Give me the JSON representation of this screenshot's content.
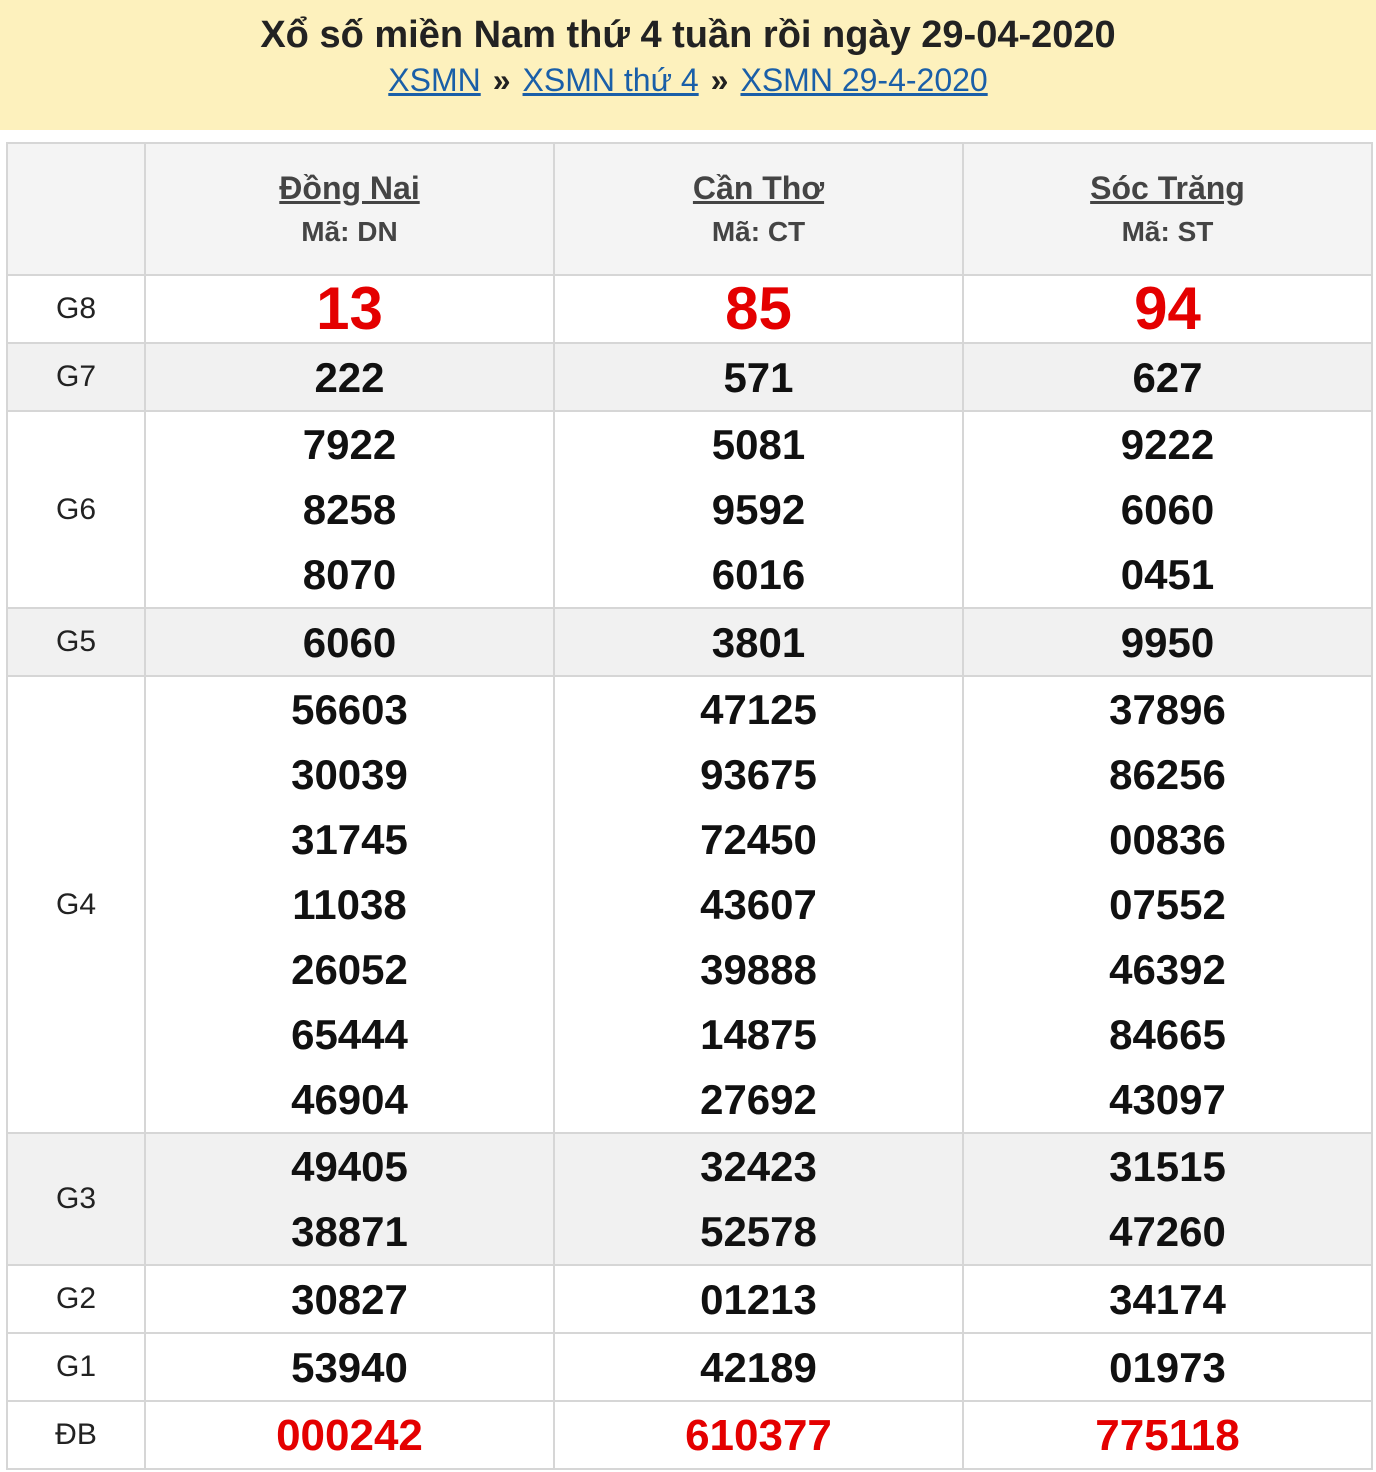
{
  "header": {
    "title": "Xổ số miền Nam thứ 4 tuần rồi ngày 29-04-2020",
    "breadcrumb": [
      "XSMN",
      "XSMN thứ 4",
      "XSMN 29-4-2020"
    ],
    "separator": "»"
  },
  "provinces": [
    {
      "name": "Đồng Nai",
      "code": "Mã: DN"
    },
    {
      "name": "Cần Thơ",
      "code": "Mã: CT"
    },
    {
      "name": "Sóc Trăng",
      "code": "Mã: ST"
    }
  ],
  "prizes": [
    {
      "label": "G8",
      "values": [
        [
          "13"
        ],
        [
          "85"
        ],
        [
          "94"
        ]
      ]
    },
    {
      "label": "G7",
      "values": [
        [
          "222"
        ],
        [
          "571"
        ],
        [
          "627"
        ]
      ]
    },
    {
      "label": "G6",
      "values": [
        [
          "7922",
          "8258",
          "8070"
        ],
        [
          "5081",
          "9592",
          "6016"
        ],
        [
          "9222",
          "6060",
          "0451"
        ]
      ]
    },
    {
      "label": "G5",
      "values": [
        [
          "6060"
        ],
        [
          "3801"
        ],
        [
          "9950"
        ]
      ]
    },
    {
      "label": "G4",
      "values": [
        [
          "56603",
          "30039",
          "31745",
          "11038",
          "26052",
          "65444",
          "46904"
        ],
        [
          "47125",
          "93675",
          "72450",
          "43607",
          "39888",
          "14875",
          "27692"
        ],
        [
          "37896",
          "86256",
          "00836",
          "07552",
          "46392",
          "84665",
          "43097"
        ]
      ]
    },
    {
      "label": "G3",
      "values": [
        [
          "49405",
          "38871"
        ],
        [
          "32423",
          "52578"
        ],
        [
          "31515",
          "47260"
        ]
      ]
    },
    {
      "label": "G2",
      "values": [
        [
          "30827"
        ],
        [
          "01213"
        ],
        [
          "34174"
        ]
      ]
    },
    {
      "label": "G1",
      "values": [
        [
          "53940"
        ],
        [
          "42189"
        ],
        [
          "01973"
        ]
      ]
    },
    {
      "label": "ĐB",
      "values": [
        [
          "000242"
        ],
        [
          "610377"
        ],
        [
          "775118"
        ]
      ]
    }
  ]
}
